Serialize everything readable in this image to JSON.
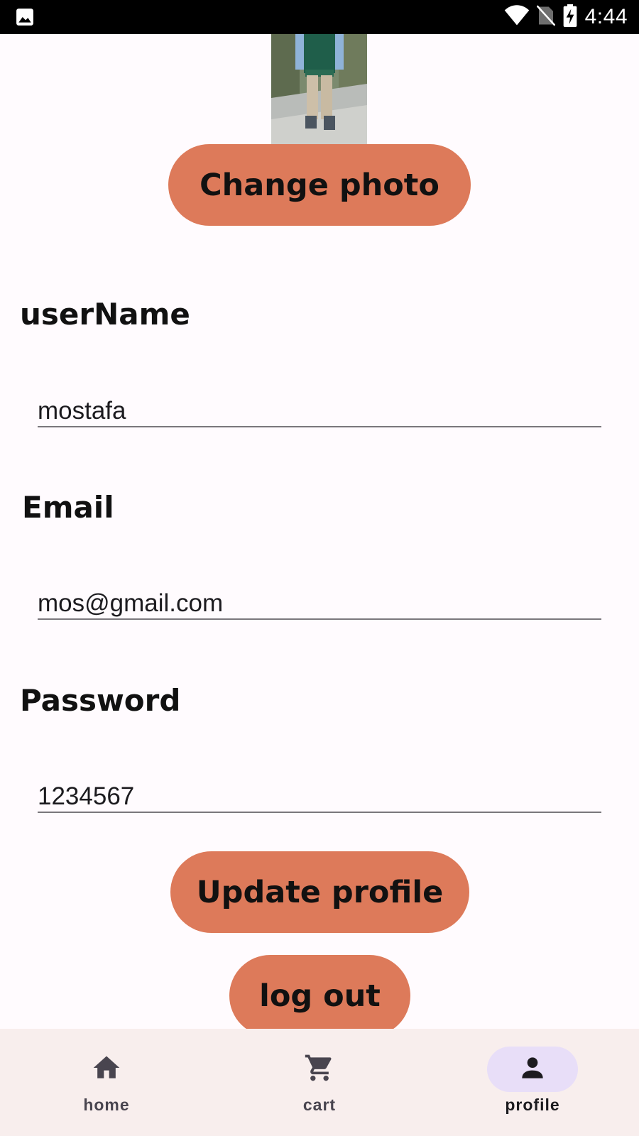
{
  "status_bar": {
    "time": "4:44",
    "icons": [
      "image-icon",
      "wifi-icon",
      "no-sim-icon",
      "battery-charging-icon"
    ]
  },
  "profile": {
    "photo": "profile-photo",
    "change_photo_label": "Change photo",
    "username_label": "userName",
    "username_value": "mostafa",
    "email_label": "Email",
    "email_value": "mos@gmail.com",
    "password_label": "Password",
    "password_value": "1234567",
    "update_label": "Update profile",
    "logout_label": "log out",
    "button_color": "#dd7a5a"
  },
  "bottom_nav": {
    "items": [
      {
        "label": "home",
        "icon": "home-icon",
        "active": false
      },
      {
        "label": "cart",
        "icon": "cart-icon",
        "active": false
      },
      {
        "label": "profile",
        "icon": "person-icon",
        "active": true
      }
    ],
    "active_indicator_color": "#e8def8"
  }
}
